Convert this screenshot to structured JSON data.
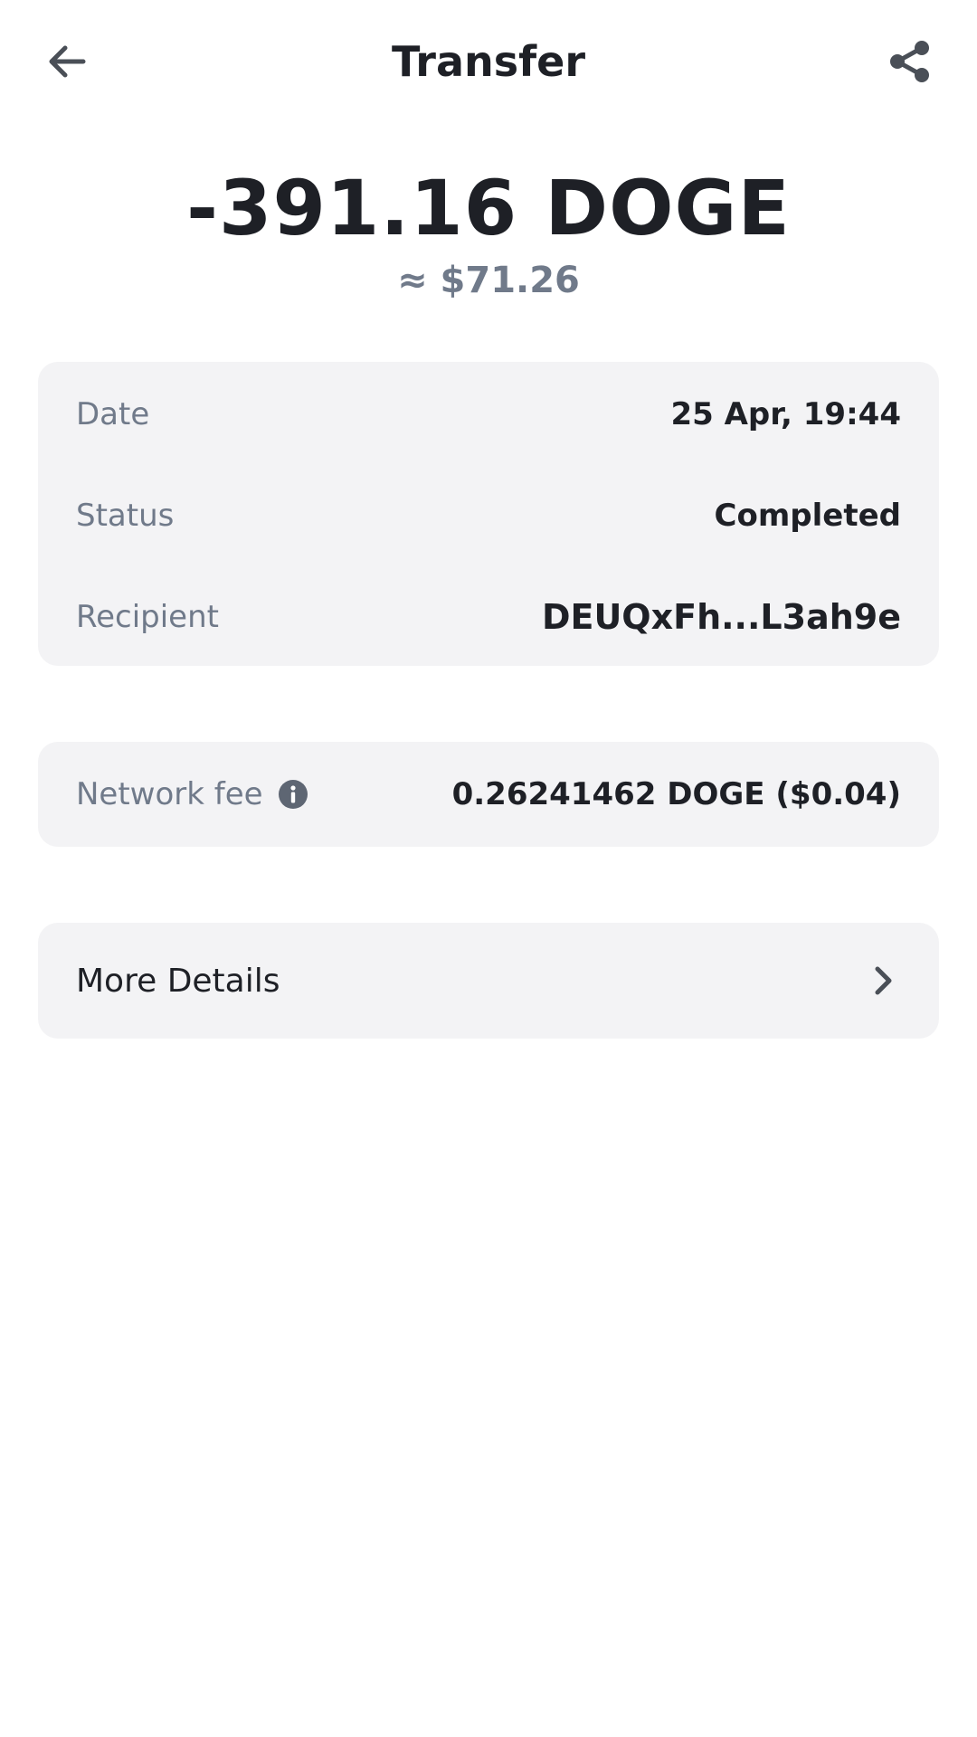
{
  "header": {
    "title": "Transfer",
    "back_icon": "arrow-left-icon",
    "share_icon": "share-icon"
  },
  "transaction": {
    "amount": "-391.16 DOGE",
    "fiat_equivalent": "≈ $71.26"
  },
  "details": {
    "date_label": "Date",
    "date_value": "25 Apr, 19:44",
    "status_label": "Status",
    "status_value": "Completed",
    "recipient_label": "Recipient",
    "recipient_value": "DEUQxFh...L3ah9e"
  },
  "fee": {
    "label": "Network fee",
    "value": "0.26241462 DOGE ($0.04)",
    "info_icon": "info-icon"
  },
  "more": {
    "label": "More Details",
    "chevron_icon": "chevron-right-icon"
  },
  "colors": {
    "primary_text": "#1e2026",
    "secondary_text": "#707a8a",
    "card_background": "#f3f3f5"
  }
}
